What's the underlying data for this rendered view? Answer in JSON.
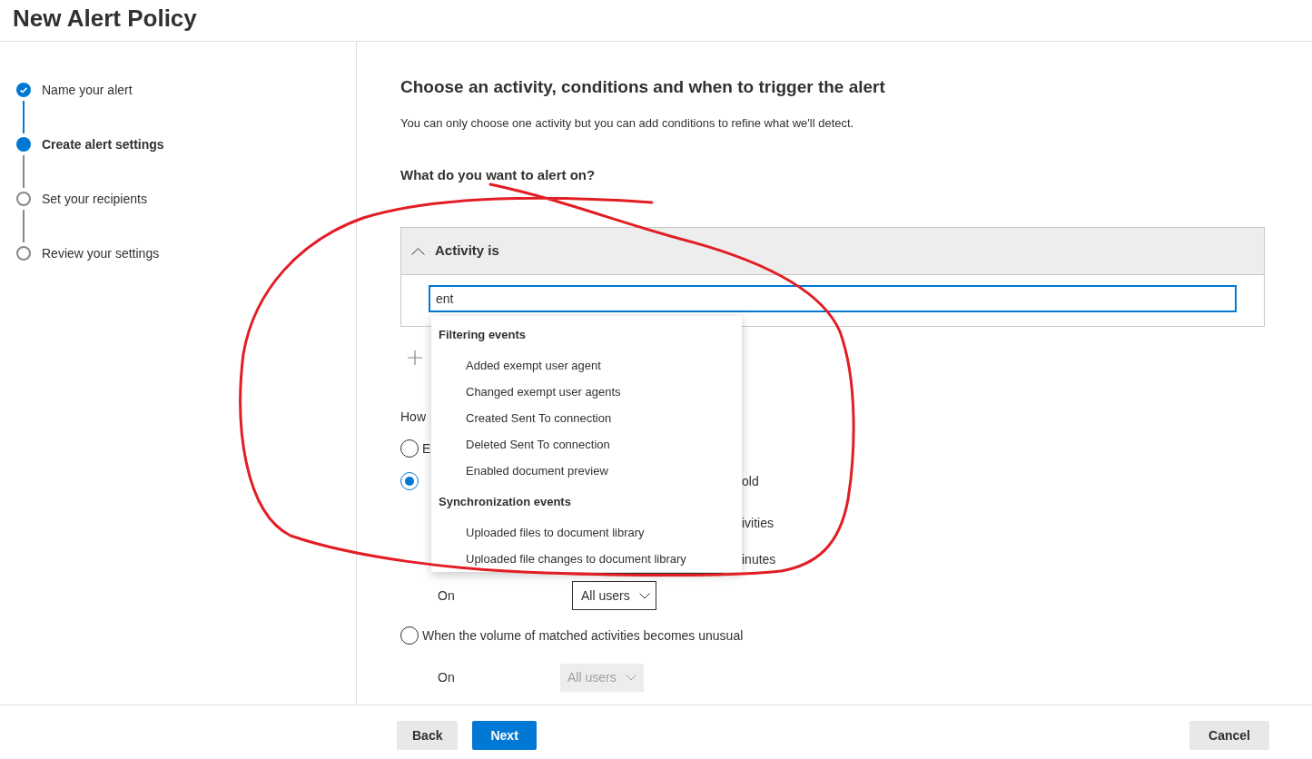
{
  "page": {
    "title": "New Alert Policy"
  },
  "steps": [
    {
      "label": "Name your alert",
      "completed": true,
      "selected": false
    },
    {
      "label": "Create alert settings",
      "completed": false,
      "selected": true
    },
    {
      "label": "Set your recipients",
      "completed": false,
      "selected": false
    },
    {
      "label": "Review your settings",
      "completed": false,
      "selected": false
    }
  ],
  "content": {
    "title": "Choose an activity, conditions and when to trigger the alert",
    "description": "You can only choose one activity but you can add conditions to refine what we'll detect.",
    "question": "What do you want to alert on?",
    "condition": {
      "title": "Activity is",
      "expanded": true,
      "search_value": "ent"
    },
    "suggestions": [
      {
        "group": "Filtering events",
        "items": [
          "Added exempt user agent",
          "Changed exempt user agents",
          "Created Sent To connection",
          "Deleted Sent To connection",
          "Enabled document preview"
        ]
      },
      {
        "group": "Synchronization events",
        "items": [
          "Uploaded files to document library",
          "Uploaded file changes to document library"
        ]
      }
    ],
    "trigger": {
      "heading": "How",
      "options": [
        {
          "label": "E",
          "selected": false
        },
        {
          "selected": true,
          "trailing_text": "old",
          "rows": [
            {
              "kind": "text",
              "trailing_text": "ivities"
            },
            {
              "kind": "field",
              "trailing_text": "inutes"
            },
            {
              "kind": "select",
              "label": "On",
              "value": "All users",
              "disabled": false
            }
          ]
        },
        {
          "label": "When the volume of matched activities becomes unusual",
          "selected": false,
          "rows": [
            {
              "kind": "select",
              "label": "On",
              "value": "All users",
              "disabled": true
            }
          ]
        }
      ]
    }
  },
  "footer": {
    "buttons": [
      {
        "label": "Back",
        "kind": "secondary"
      },
      {
        "label": "Next",
        "kind": "primary"
      }
    ],
    "cancel": "Cancel"
  }
}
